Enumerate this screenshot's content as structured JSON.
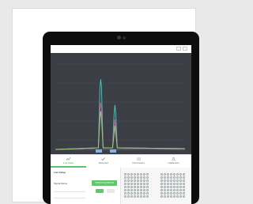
{
  "app": {
    "chart_title": "Chromatogram / Signal"
  },
  "tabs": [
    {
      "label": "Live Data",
      "icon": "chart-icon",
      "active": true
    },
    {
      "label": "Detected",
      "icon": "check-icon",
      "active": false
    },
    {
      "label": "Parameters",
      "icon": "sliders-icon",
      "active": false
    },
    {
      "label": "Calibration",
      "icon": "flask-icon",
      "active": false
    }
  ],
  "left_panel": {
    "title": "Live Setup",
    "row1_label": "Signal Name",
    "button_label": "START ACQUISITION"
  },
  "colors": {
    "accent": "#5cc46a",
    "chart_bg": "#3b3f45"
  },
  "chart_data": {
    "type": "line",
    "title": "",
    "series": [
      {
        "color": "#3fd0c8",
        "peaks": [
          {
            "x": 0.35,
            "y": 0.82
          },
          {
            "x": 0.46,
            "y": 0.52
          }
        ]
      },
      {
        "color": "#e04a8f",
        "peaks": [
          {
            "x": 0.35,
            "y": 0.55
          },
          {
            "x": 0.46,
            "y": 0.35
          }
        ]
      },
      {
        "color": "#9cd27a",
        "peaks": [
          {
            "x": 0.35,
            "y": 0.45
          },
          {
            "x": 0.46,
            "y": 0.28
          }
        ]
      }
    ]
  }
}
